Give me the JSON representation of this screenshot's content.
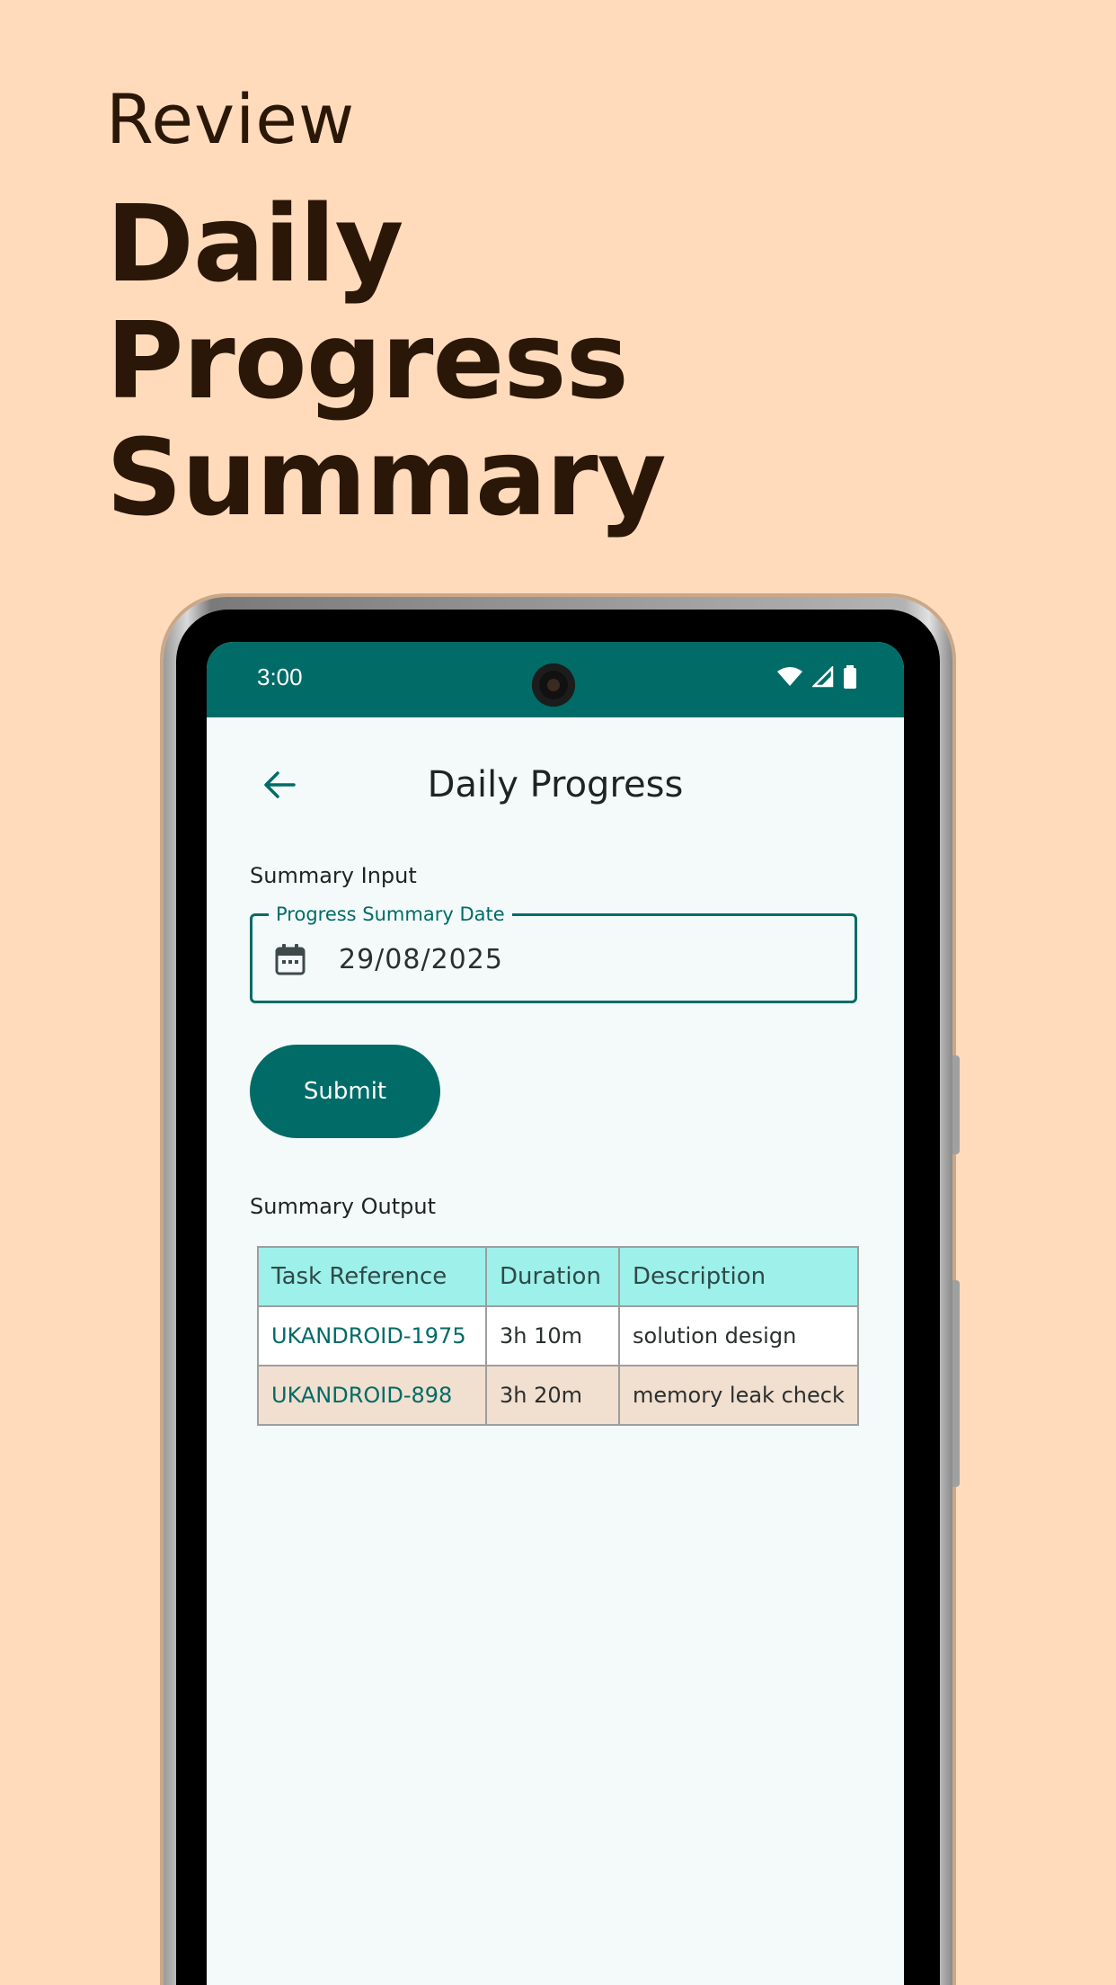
{
  "promo": {
    "kicker": "Review",
    "title_lines": [
      "Daily",
      "Progress",
      "Summary"
    ]
  },
  "status_bar": {
    "time": "3:00",
    "icons": [
      "wifi-icon",
      "signal-icon",
      "battery-icon"
    ]
  },
  "app_bar": {
    "title": "Daily Progress",
    "back_icon": "arrow-left-icon"
  },
  "input_section": {
    "label": "Summary Input",
    "date_field": {
      "label": "Progress Summary Date",
      "value": "29/08/2025",
      "icon": "calendar-icon"
    },
    "submit_label": "Submit"
  },
  "output_section": {
    "label": "Summary Output",
    "columns": [
      "Task Reference",
      "Duration",
      "Description"
    ],
    "rows": [
      {
        "task_reference": "UKANDROID-1975",
        "duration": "3h 10m",
        "description": "solution design"
      },
      {
        "task_reference": "UKANDROID-898",
        "duration": "3h 20m",
        "description": "memory leak check"
      }
    ]
  },
  "colors": {
    "background": "#FFDBBB",
    "primary": "#006B67",
    "header_cell": "#9EF0EA",
    "alt_row": "#F1DFCF",
    "text_dark": "#2A1708"
  }
}
